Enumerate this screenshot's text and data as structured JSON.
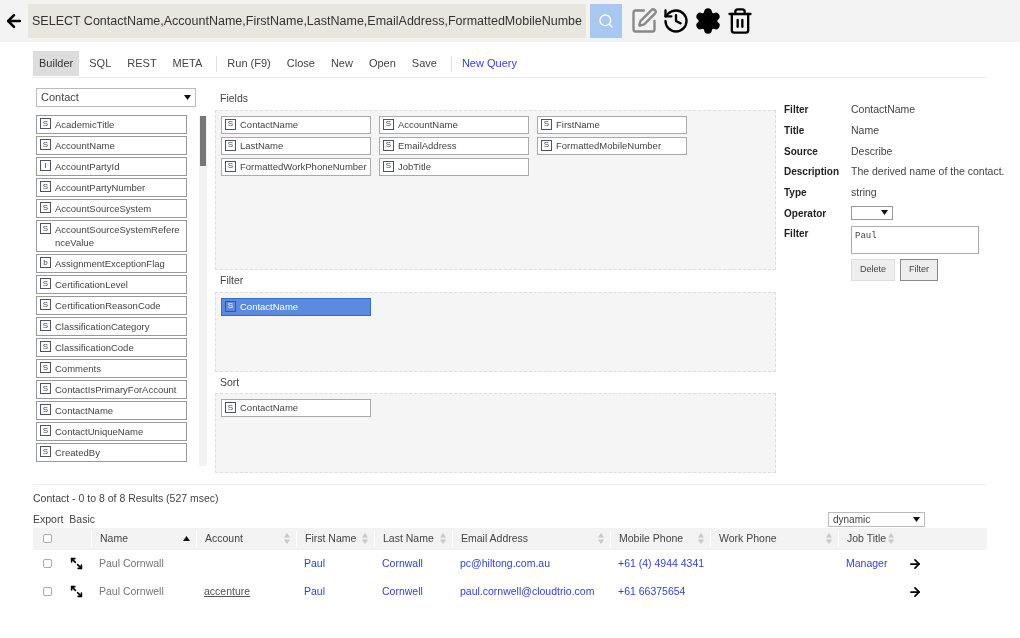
{
  "query": {
    "value": "SELECT ContactName,AccountName,FirstName,LastName,EmailAddress,FormattedMobileNumbe"
  },
  "toolbar": [
    {
      "label": "Builder",
      "selected": true,
      "kind": "mode"
    },
    {
      "label": "SQL",
      "selected": false,
      "kind": "mode"
    },
    {
      "label": "REST",
      "selected": false,
      "kind": "mode"
    },
    {
      "label": "META",
      "selected": false,
      "kind": "mode"
    },
    {
      "label": "Run (F9)",
      "selected": false,
      "kind": "action"
    },
    {
      "label": "Close",
      "selected": false,
      "kind": "action"
    },
    {
      "label": "New",
      "selected": false,
      "kind": "action"
    },
    {
      "label": "Open",
      "selected": false,
      "kind": "action"
    },
    {
      "label": "Save",
      "selected": false,
      "kind": "action"
    },
    {
      "label": "New Query",
      "selected": false,
      "kind": "link"
    }
  ],
  "object_select": {
    "value": "Contact"
  },
  "attributes": [
    {
      "type": "S",
      "name": "AcademicTitle"
    },
    {
      "type": "S",
      "name": "AccountName"
    },
    {
      "type": "I",
      "name": "AccountPartyId"
    },
    {
      "type": "S",
      "name": "AccountPartyNumber"
    },
    {
      "type": "S",
      "name": "AccountSourceSystem"
    },
    {
      "type": "S",
      "name": "AccountSourceSystemReferenceValue"
    },
    {
      "type": "b",
      "name": "AssignmentExceptionFlag"
    },
    {
      "type": "S",
      "name": "CertificationLevel"
    },
    {
      "type": "S",
      "name": "CertificationReasonCode"
    },
    {
      "type": "S",
      "name": "ClassificationCategory"
    },
    {
      "type": "S",
      "name": "ClassificationCode"
    },
    {
      "type": "S",
      "name": "Comments"
    },
    {
      "type": "S",
      "name": "ContactIsPrimaryForAccount"
    },
    {
      "type": "S",
      "name": "ContactName"
    },
    {
      "type": "S",
      "name": "ContactUniqueName"
    },
    {
      "type": "S",
      "name": "CreatedBy"
    }
  ],
  "sections": [
    {
      "title": "Fields",
      "items": [
        {
          "type": "S",
          "name": "ContactName",
          "selected": false
        },
        {
          "type": "S",
          "name": "AccountName",
          "selected": false
        },
        {
          "type": "S",
          "name": "FirstName",
          "selected": false
        },
        {
          "type": "S",
          "name": "LastName",
          "selected": false
        },
        {
          "type": "S",
          "name": "EmailAddress",
          "selected": false
        },
        {
          "type": "S",
          "name": "FormattedMobileNumber",
          "selected": false
        },
        {
          "type": "S",
          "name": "FormattedWorkPhoneNumber",
          "selected": false
        },
        {
          "type": "S",
          "name": "JobTitle",
          "selected": false
        }
      ]
    },
    {
      "title": "Filter",
      "items": [
        {
          "type": "S",
          "name": "ContactName",
          "selected": true
        }
      ]
    },
    {
      "title": "Sort",
      "items": [
        {
          "type": "S",
          "name": "ContactName",
          "selected": false
        }
      ]
    }
  ],
  "details": {
    "rows": [
      {
        "label": "Filter",
        "value": "ContactName"
      },
      {
        "label": "Title",
        "value": "Name"
      },
      {
        "label": "Source",
        "value": "Describe"
      },
      {
        "label": "Description",
        "value": "The derived name of the contact."
      },
      {
        "label": "Type",
        "value": "string"
      }
    ],
    "operator_label": "Operator",
    "filter_label": "Filter",
    "filter_value": "Paul",
    "buttons": [
      "Delete",
      "Filter"
    ]
  },
  "results": {
    "summary": "Contact - 0 to 8 of 8 Results (527 msec)",
    "links": [
      "Export",
      "Basic"
    ],
    "view_select": "dynamic",
    "select_all_checked": false,
    "columns": [
      {
        "label": "Name",
        "sorted": true
      },
      {
        "label": "Account",
        "sorted": false
      },
      {
        "label": "First Name",
        "sorted": false
      },
      {
        "label": "Last Name",
        "sorted": false
      },
      {
        "label": "Email Address",
        "sorted": false
      },
      {
        "label": "Mobile Phone",
        "sorted": false
      },
      {
        "label": "Work Phone",
        "sorted": false
      },
      {
        "label": "Job Title",
        "sorted": false
      }
    ],
    "rows": [
      {
        "checked": false,
        "cells": [
          "Paul Cornwall",
          "",
          "Paul",
          "Cornwall",
          "pc@hiltong.com.au",
          "+61 (4) 4944 4341",
          "",
          "Manager"
        ]
      },
      {
        "checked": false,
        "cells": [
          "Paul Cornwell",
          "accenture",
          "Paul",
          "Cornwell",
          "paul.cornwell@cloudtrio.com",
          "+61 66375654",
          "",
          ""
        ]
      }
    ]
  }
}
